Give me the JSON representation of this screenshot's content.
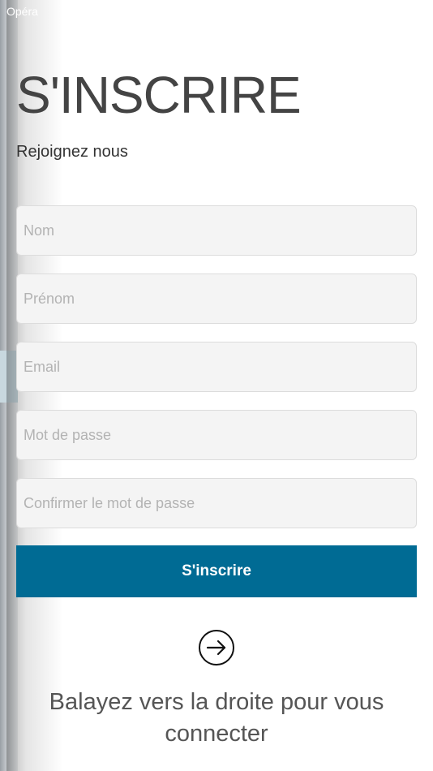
{
  "status_bar": {
    "carrier": "Opéra"
  },
  "header": {
    "title": "S'INSCRIRE",
    "subtitle": "Rejoignez nous"
  },
  "form": {
    "nom_placeholder": "Nom",
    "prenom_placeholder": "Prénom",
    "email_placeholder": "Email",
    "password_placeholder": "Mot de passe",
    "confirm_password_placeholder": "Confirmer le mot de passe",
    "submit_label": "S'inscrire"
  },
  "navigation": {
    "icon": "arrow-right-circle-icon",
    "swipe_hint": "Balayez vers la droite pour vous connecter"
  },
  "colors": {
    "primary": "#006b94",
    "field_background": "#f4f4f4",
    "text": "#444444"
  }
}
